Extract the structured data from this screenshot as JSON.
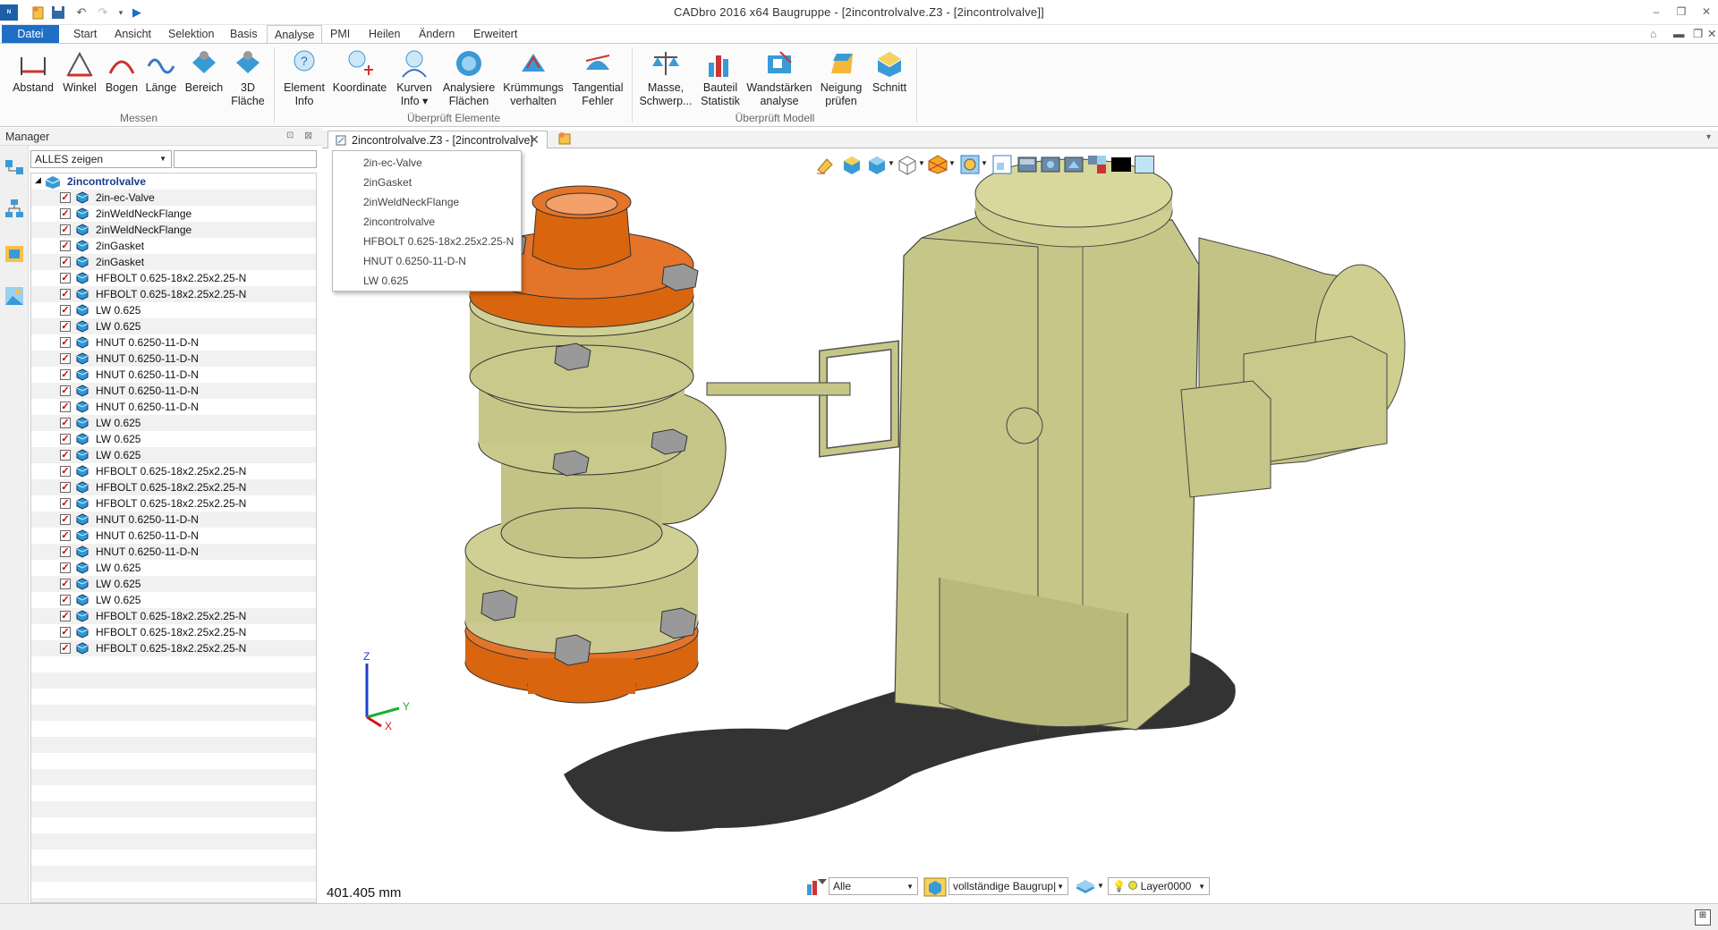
{
  "app": {
    "title": "CADbro 2016 x64        Baugruppe - [2incontrolvalve.Z3 - [2incontrolvalve]]"
  },
  "tabs": [
    {
      "label": "Datei"
    },
    {
      "label": "Start"
    },
    {
      "label": "Ansicht"
    },
    {
      "label": "Selektion"
    },
    {
      "label": "Basis"
    },
    {
      "label": "Analyse"
    },
    {
      "label": "PMI"
    },
    {
      "label": "Heilen"
    },
    {
      "label": "Ändern"
    },
    {
      "label": "Erweitert"
    }
  ],
  "ribbon": {
    "groups": {
      "messen": "Messen",
      "elemente": "Überprüft Elemente",
      "modell": "Überprüft Modell"
    },
    "buttons": {
      "abstand": "Abstand",
      "winkel": "Winkel",
      "bogen": "Bogen",
      "laenge": "Länge",
      "bereich": "Bereich",
      "flaeche3d_1": "3D",
      "flaeche3d_2": "Fläche",
      "element_1": "Element",
      "element_2": "Info",
      "koordinate": "Koordinate",
      "kurven_1": "Kurven",
      "kurven_2": "Info",
      "analysiere_1": "Analysiere",
      "analysiere_2": "Flächen",
      "kruemmung_1": "Krümmungs",
      "kruemmung_2": "verhalten",
      "tangential_1": "Tangential",
      "tangential_2": "Fehler",
      "masse_1": "Masse,",
      "masse_2": "Schwerp...",
      "bauteil_1": "Bauteil",
      "bauteil_2": "Statistik",
      "wand_1": "Wandstärken",
      "wand_2": "analyse",
      "neigung_1": "Neigung",
      "neigung_2": "prüfen",
      "schnitt": "Schnitt"
    }
  },
  "manager": {
    "title": "Manager",
    "filter": "ALLES zeigen",
    "root": "2incontrolvalve",
    "items": [
      "2in-ec-Valve",
      "2inWeldNeckFlange",
      "2inWeldNeckFlange",
      "2inGasket",
      "2inGasket",
      "HFBOLT 0.625-18x2.25x2.25-N",
      "HFBOLT 0.625-18x2.25x2.25-N",
      "LW 0.625",
      "LW 0.625",
      "HNUT 0.6250-11-D-N",
      "HNUT 0.6250-11-D-N",
      "HNUT 0.6250-11-D-N",
      "HNUT 0.6250-11-D-N",
      "HNUT 0.6250-11-D-N",
      "LW 0.625",
      "LW 0.625",
      "LW 0.625",
      "HFBOLT 0.625-18x2.25x2.25-N",
      "HFBOLT 0.625-18x2.25x2.25-N",
      "HFBOLT 0.625-18x2.25x2.25-N",
      "HNUT 0.6250-11-D-N",
      "HNUT 0.6250-11-D-N",
      "HNUT 0.6250-11-D-N",
      "LW 0.625",
      "LW 0.625",
      "LW 0.625",
      "HFBOLT 0.625-18x2.25x2.25-N",
      "HFBOLT 0.625-18x2.25x2.25-N",
      "HFBOLT 0.625-18x2.25x2.25-N"
    ]
  },
  "document": {
    "tab": "2incontrolvalve.Z3 - [2incontrolvalve]",
    "dropdown": [
      "2in-ec-Valve",
      "2inGasket",
      "2inWeldNeckFlange",
      "2incontrolvalve",
      "HFBOLT 0.625-18x2.25x2.25-N",
      "HNUT 0.6250-11-D-N",
      "LW 0.625"
    ],
    "measure": "401.405 mm",
    "axes": {
      "z": "Z",
      "y": "Y",
      "x": "X"
    }
  },
  "bottom": {
    "filter": "Alle",
    "mode": "vollständige Baugrup|",
    "layer": "Layer0000"
  },
  "colors": {
    "accent": "#1e6fc5",
    "flange": "#d9650f",
    "body": "#c9c98a",
    "cube": "#2a9ad6"
  }
}
